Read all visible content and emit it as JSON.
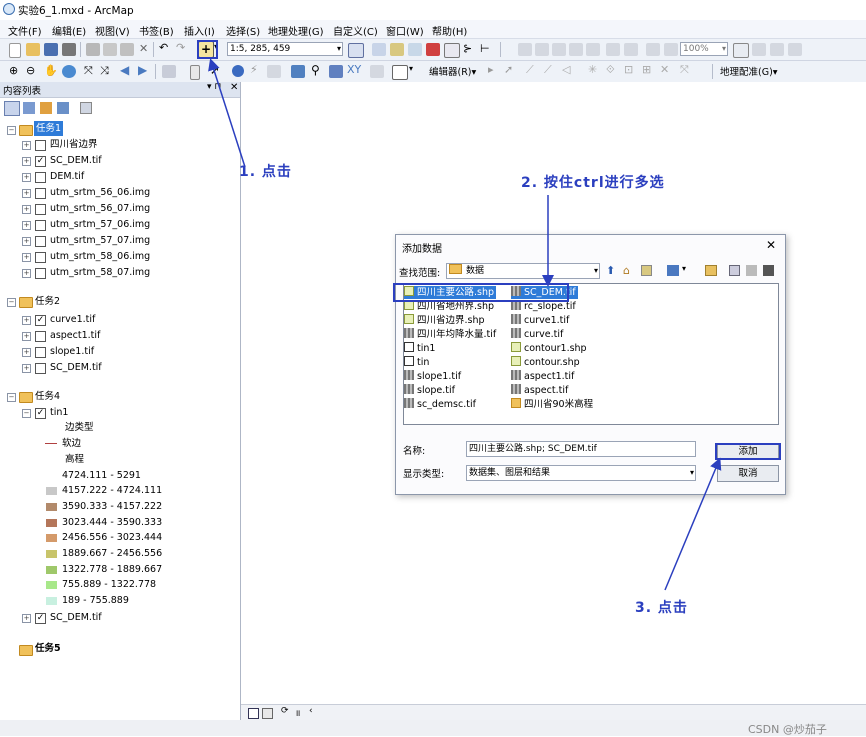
{
  "window": {
    "title": "实验6_1.mxd - ArcMap"
  },
  "menubar": {
    "items": [
      "文件(F)",
      "编辑(E)",
      "视图(V)",
      "书签(B)",
      "插入(I)",
      "选择(S)",
      "地理处理(G)",
      "自定义(C)",
      "窗口(W)",
      "帮助(H)"
    ]
  },
  "toolbar": {
    "scale_value": "1:5, 285, 459",
    "zoom_value": "100%",
    "editor_label": "编辑器(R)▾",
    "georef_label": "地理配准(G)▾"
  },
  "toc": {
    "title": "内容列表",
    "groups": [
      {
        "name": "任务1",
        "layers": [
          "四川省边界",
          "SC_DEM.tif",
          "DEM.tif",
          "utm_srtm_56_06.img",
          "utm_srtm_56_07.img",
          "utm_srtm_57_06.img",
          "utm_srtm_57_07.img",
          "utm_srtm_58_06.img",
          "utm_srtm_58_07.img"
        ]
      },
      {
        "name": "任务2",
        "layers": [
          "curve1.tif",
          "aspect1.tif",
          "slope1.tif",
          "SC_DEM.tif"
        ]
      },
      {
        "name": "任务4",
        "layers": [
          "tin1",
          "SC_DEM.tif"
        ],
        "tin_legend": {
          "edge_type": "边类型",
          "soft_edge": "软边",
          "elevation": "高程",
          "classes": [
            "4724.111 - 5291",
            "4157.222 - 4724.111",
            "3590.333 - 4157.222",
            "3023.444 - 3590.333",
            "2456.556 - 3023.444",
            "1889.667 - 2456.556",
            "1322.778 - 1889.667",
            "755.889 - 1322.778",
            "189 - 755.889"
          ],
          "colors": [
            "#ffffff",
            "#c8c8c8",
            "#b28a6b",
            "#b4765a",
            "#d49a6a",
            "#c8c46a",
            "#9fc86a",
            "#a8e88a",
            "#c8f0e0"
          ]
        }
      },
      {
        "name": "任务5",
        "layers": []
      }
    ]
  },
  "dialog": {
    "title": "添加数据",
    "look_in_label": "查找范围:",
    "look_in_value": "数据",
    "files_col1": [
      "四川主要公路.shp",
      "四川省地州界.shp",
      "四川省边界.shp",
      "四川年均降水量.tif",
      "tin1",
      "tin",
      "slope1.tif",
      "slope.tif",
      "sc_demsc.tif"
    ],
    "files_col2": [
      "SC_DEM.tif",
      "rc_slope.tif",
      "curve1.tif",
      "curve.tif",
      "contour1.shp",
      "contour.shp",
      "aspect1.tif",
      "aspect.tif",
      "四川省90米高程"
    ],
    "name_label": "名称:",
    "name_value": "四川主要公路.shp; SC_DEM.tif",
    "type_label": "显示类型:",
    "type_value": "数据集、图层和结果",
    "add_button": "添加",
    "cancel_button": "取消"
  },
  "annotations": {
    "step1": "1. 点击",
    "step2": "2. 按住ctrl进行多选",
    "step3": "3. 点击"
  },
  "watermark": "CSDN @炒茄子"
}
